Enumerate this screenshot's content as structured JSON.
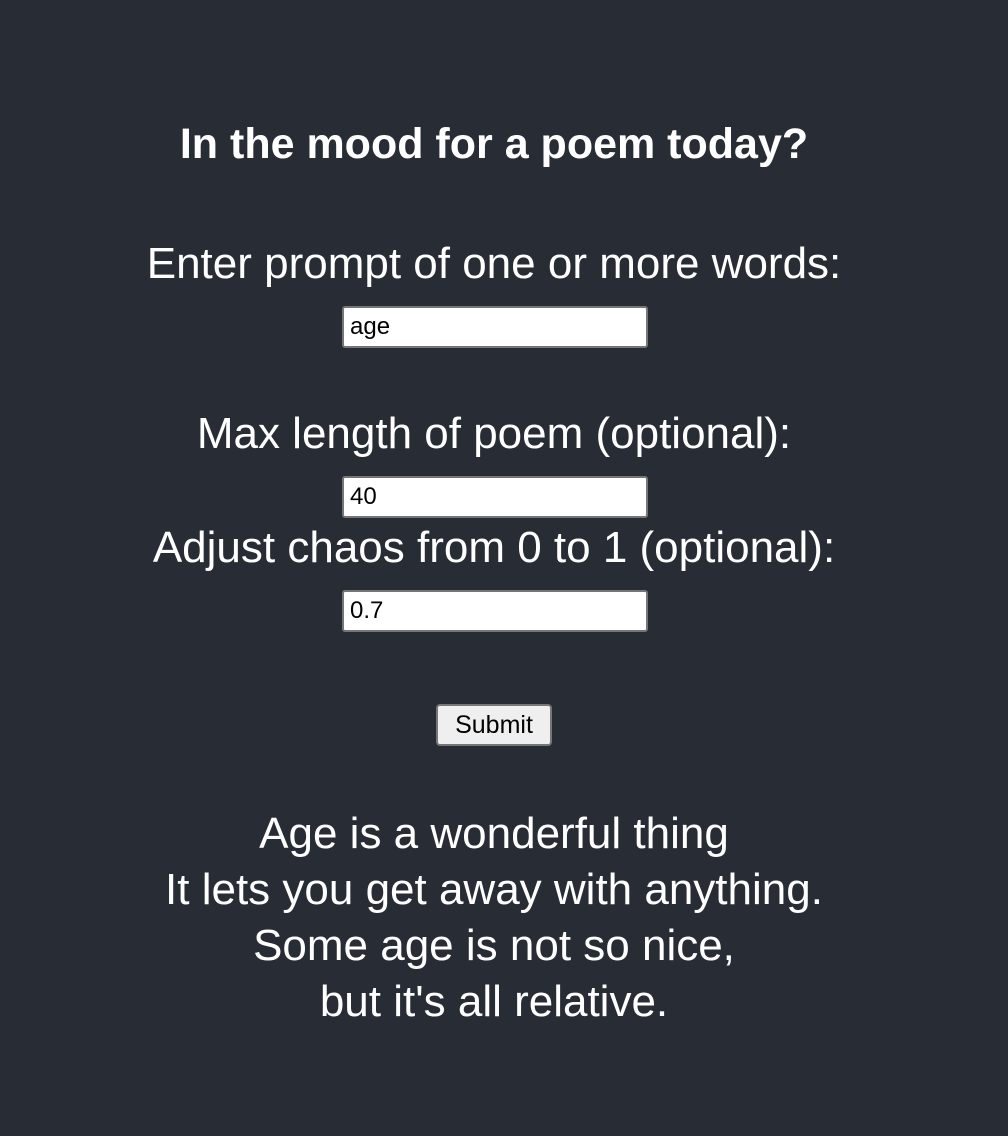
{
  "heading": "In the mood for a poem today?",
  "prompt_field": {
    "label": "Enter prompt of one or more words:",
    "value": "age"
  },
  "length_field": {
    "label": "Max length of poem (optional):",
    "value": "40"
  },
  "chaos_field": {
    "label": "Adjust chaos from 0 to 1 (optional):",
    "value": "0.7"
  },
  "submit_label": "Submit",
  "poem": {
    "lines": [
      "Age is a wonderful thing",
      "It lets you get away with anything.",
      "Some age is not so nice,",
      "but it's all relative."
    ]
  }
}
